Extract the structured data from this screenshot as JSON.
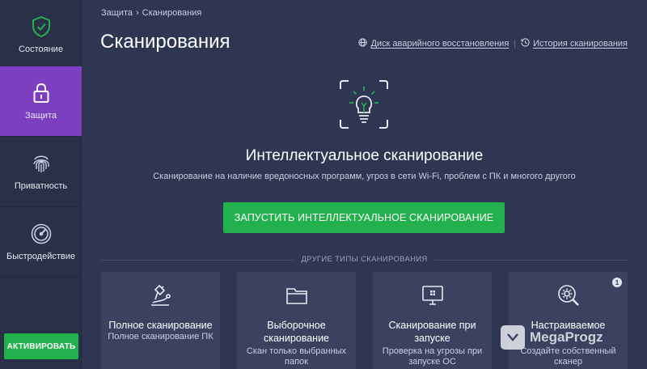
{
  "sidebar": {
    "items": [
      {
        "label": "Состояние",
        "icon": "shield-check-icon",
        "active": false
      },
      {
        "label": "Защита",
        "icon": "lock-icon",
        "active": true
      },
      {
        "label": "Приватность",
        "icon": "fingerprint-icon",
        "active": false
      },
      {
        "label": "Быстродействие",
        "icon": "speedometer-icon",
        "active": false
      }
    ],
    "activate_label": "АКТИВИРОВАТЬ"
  },
  "breadcrumb": {
    "parent": "Защита",
    "separator": "›",
    "current": "Сканирования"
  },
  "header": {
    "title": "Сканирования",
    "links": [
      {
        "label": "Диск аварийного восстановления",
        "icon": "globe-icon"
      },
      {
        "label": "История сканирования",
        "icon": "history-icon"
      }
    ],
    "link_separator": "|"
  },
  "hero": {
    "icon": "lightbulb-icon",
    "title": "Интеллектуальное сканирование",
    "subtitle": "Сканирование на наличие вредоносных программ, угроз в сети Wi-Fi, проблем с ПК и многого другого",
    "button_label": "ЗАПУСТИТЬ ИНТЕЛЛЕКТУАЛЬНОЕ СКАНИРОВАНИЕ"
  },
  "other_scans": {
    "label": "ДРУГИЕ ТИПЫ СКАНИРОВАНИЯ",
    "cards": [
      {
        "title": "Полное сканирование",
        "desc": "Полное сканирование ПК",
        "icon": "microscope-icon"
      },
      {
        "title": "Выборочное сканирование",
        "desc": "Скан только выбранных папок",
        "icon": "folder-icon"
      },
      {
        "title": "Сканирование при запуске",
        "desc": "Проверка на угрозы при запуске ОС",
        "icon": "monitor-icon"
      },
      {
        "title": "Настраиваемое",
        "desc": "Создайте собственный сканер",
        "icon": "gear-search-icon",
        "badge": "1"
      }
    ]
  },
  "watermark": {
    "text": "MegaProgz"
  },
  "colors": {
    "accent_green": "#22b14c",
    "active_purple": "#7c3fbf",
    "background": "#2f3651",
    "card": "#3a4260"
  }
}
